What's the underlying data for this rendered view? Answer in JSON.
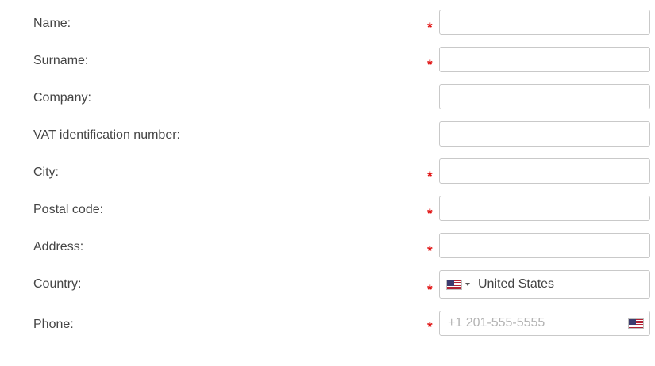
{
  "form": {
    "fields": {
      "name": {
        "label": "Name:",
        "required": true,
        "value": ""
      },
      "surname": {
        "label": "Surname:",
        "required": true,
        "value": ""
      },
      "company": {
        "label": "Company:",
        "required": false,
        "value": ""
      },
      "vat": {
        "label": "VAT identification number:",
        "required": false,
        "value": ""
      },
      "city": {
        "label": "City:",
        "required": true,
        "value": ""
      },
      "postal_code": {
        "label": "Postal code:",
        "required": true,
        "value": ""
      },
      "address": {
        "label": "Address:",
        "required": true,
        "value": ""
      },
      "country": {
        "label": "Country:",
        "required": true,
        "value": "United States",
        "flag_icon": "us-flag-icon"
      },
      "phone": {
        "label": "Phone:",
        "required": true,
        "value": "",
        "placeholder": "+1 201-555-5555",
        "flag_icon": "us-flag-icon"
      }
    },
    "required_marker": "*",
    "colors": {
      "required_marker": "#e01010",
      "label_text": "#444444",
      "field_border": "#c9c9c9",
      "placeholder": "#b3b3b3"
    }
  }
}
